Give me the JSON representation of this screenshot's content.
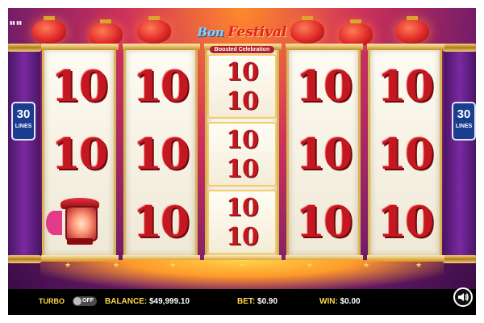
{
  "game": {
    "logo_line1": "Bon",
    "logo_line2": "Festival",
    "logo_subtitle": "Boosted Celebration"
  },
  "lines_badge": {
    "count": "30",
    "label": "LINES"
  },
  "reels": [
    [
      "10",
      "10",
      "lantern"
    ],
    [
      "10",
      "10",
      "10"
    ],
    [
      "10",
      "10",
      "10",
      "10",
      "10",
      "10"
    ],
    [
      "10",
      "10",
      "10"
    ],
    [
      "10",
      "10",
      "10"
    ]
  ],
  "bottom_bar": {
    "turbo_label": "TURBO",
    "turbo_state": "OFF",
    "balance_label": "BALANCE:",
    "balance_value": "$49,999.10",
    "bet_label": "BET:",
    "bet_value": "$0.90",
    "win_label": "WIN:",
    "win_value": "$0.00"
  },
  "icons": {
    "sound": "speaker-icon",
    "lantern_symbol": "paper-lantern-icon"
  },
  "colors": {
    "symbol_red": "#c41820",
    "badge_blue": "#1a3d8f",
    "label_yellow": "#ffd84a"
  }
}
